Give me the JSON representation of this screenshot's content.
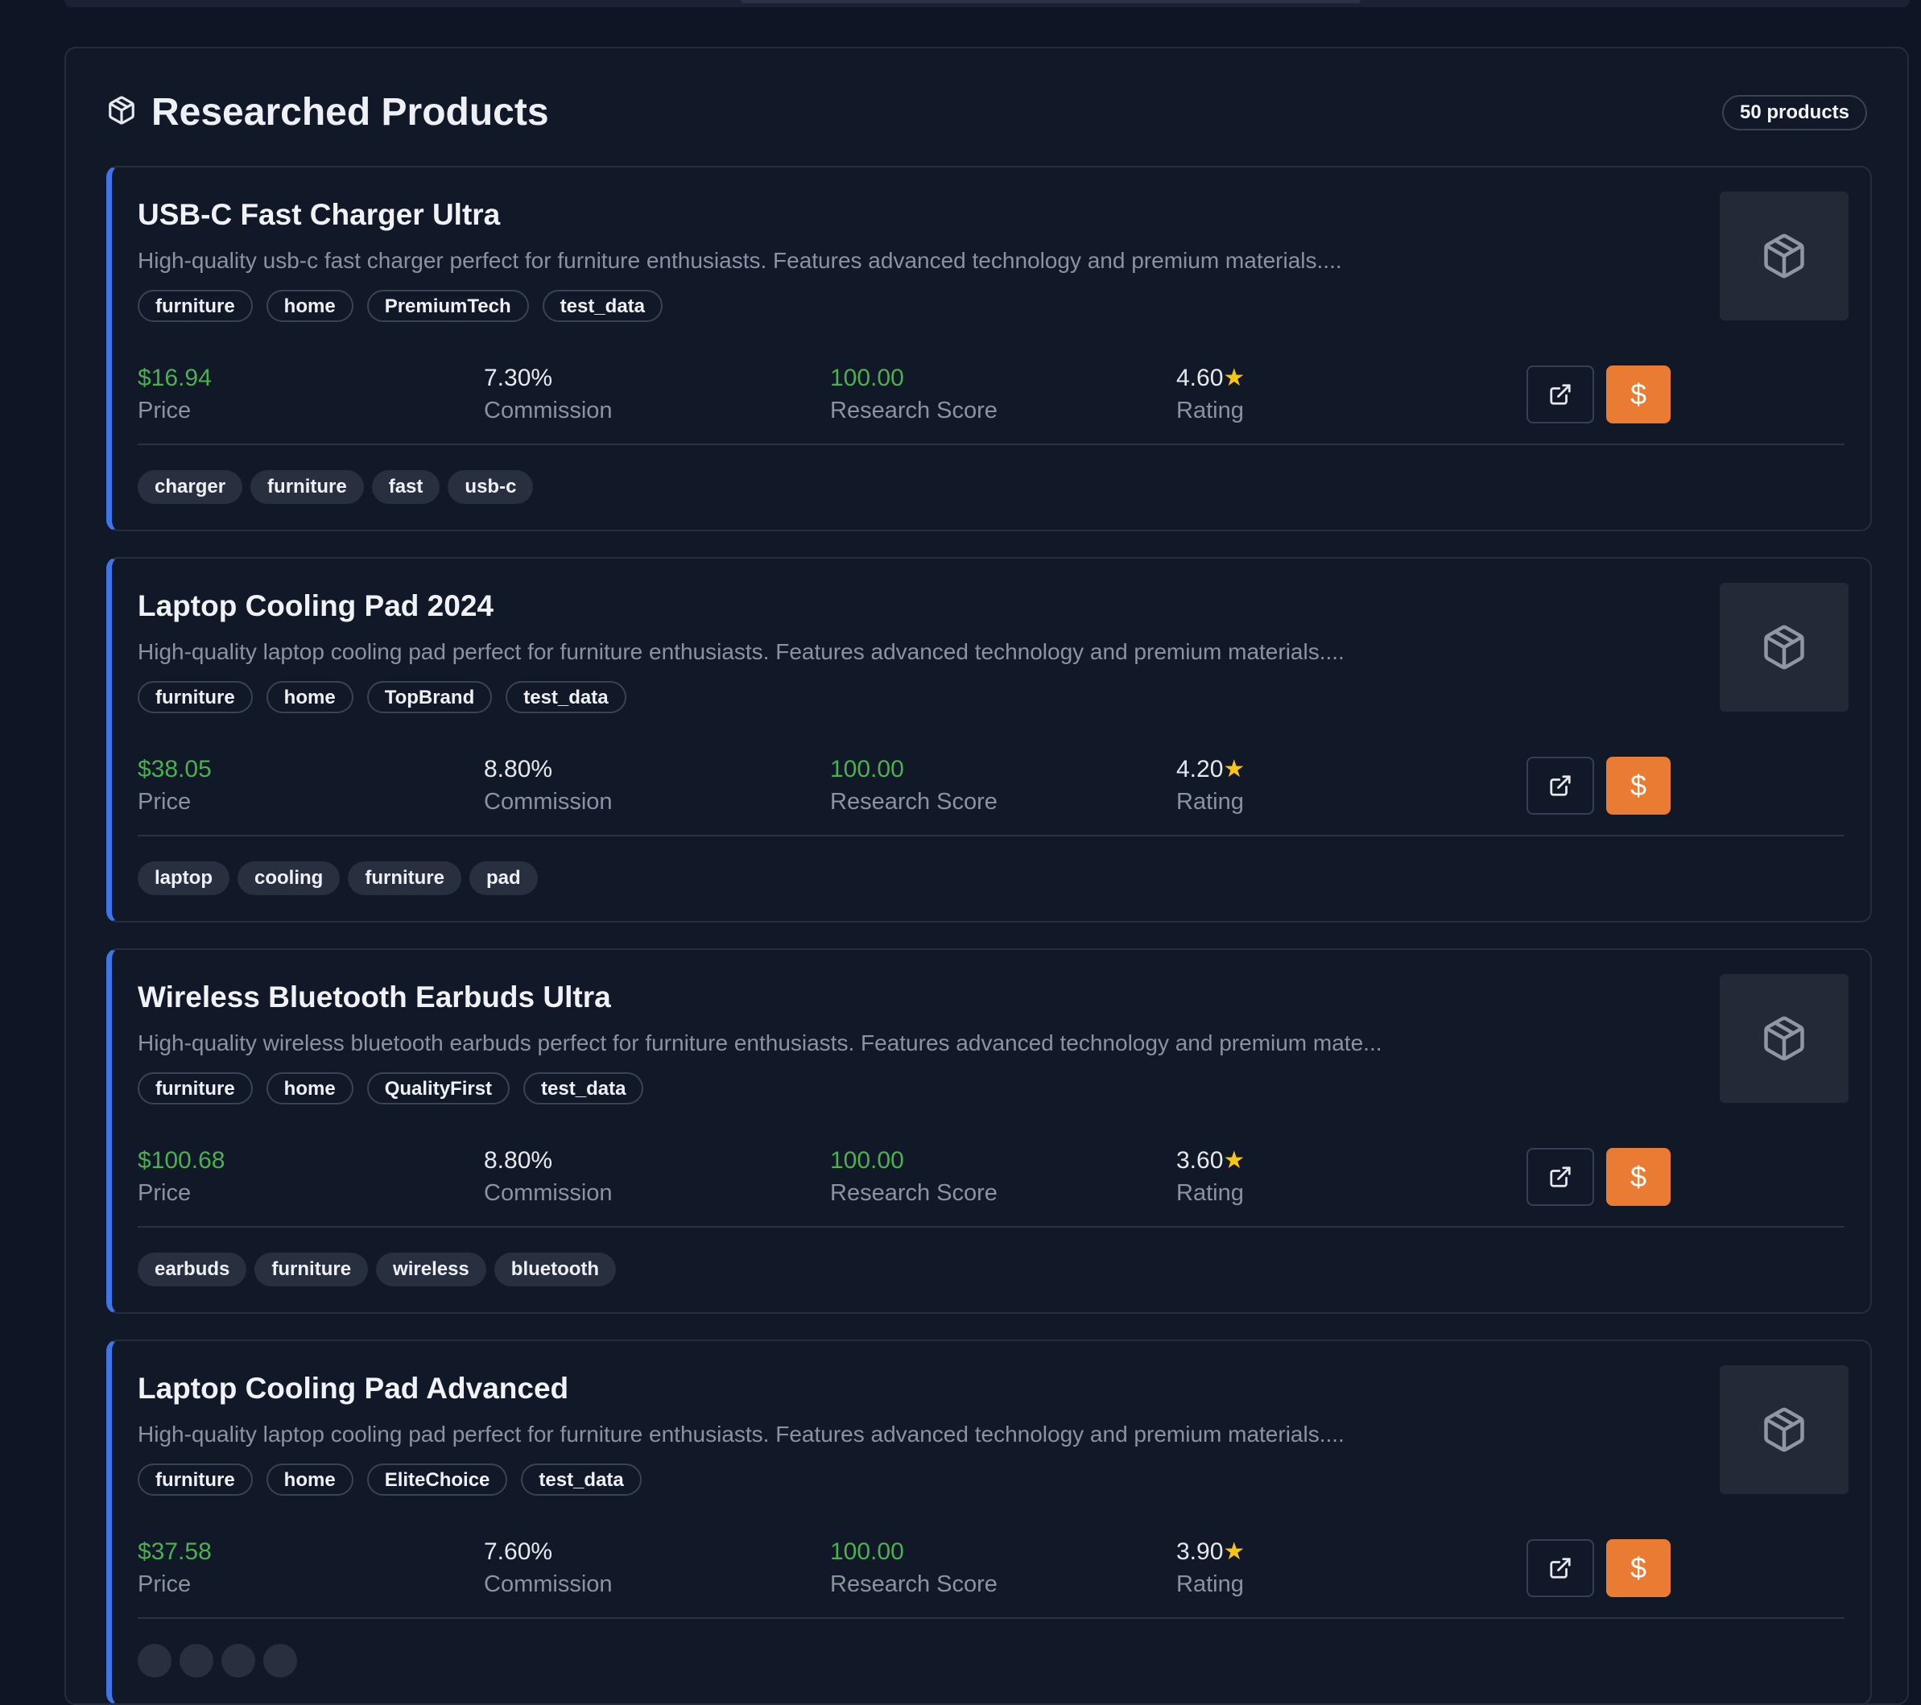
{
  "section": {
    "title": "Researched Products",
    "count_label": "50 products"
  },
  "labels": {
    "price": "Price",
    "commission": "Commission",
    "research_score": "Research Score",
    "rating": "Rating"
  },
  "colors": {
    "accent_border": "#3f75e6",
    "price_green": "#4caf50",
    "buy_orange": "#ea7b32",
    "star_yellow": "#f5c518"
  },
  "icons": {
    "section": "package-icon",
    "thumbnail": "package-icon",
    "open_link": "external-link-icon",
    "buy": "dollar-icon",
    "rating": "star-icon"
  },
  "products": [
    {
      "name": "USB-C Fast Charger Ultra",
      "description": "High-quality usb-c fast charger perfect for furniture enthusiasts. Features advanced technology and premium materials....",
      "categories": [
        "furniture",
        "home",
        "PremiumTech",
        "test_data"
      ],
      "price": "$16.94",
      "commission": "7.30%",
      "research_score": "100.00",
      "rating": "4.60",
      "tags": [
        "charger",
        "furniture",
        "fast",
        "usb-c"
      ]
    },
    {
      "name": "Laptop Cooling Pad 2024",
      "description": "High-quality laptop cooling pad perfect for furniture enthusiasts. Features advanced technology and premium materials....",
      "categories": [
        "furniture",
        "home",
        "TopBrand",
        "test_data"
      ],
      "price": "$38.05",
      "commission": "8.80%",
      "research_score": "100.00",
      "rating": "4.20",
      "tags": [
        "laptop",
        "cooling",
        "furniture",
        "pad"
      ]
    },
    {
      "name": "Wireless Bluetooth Earbuds Ultra",
      "description": "High-quality wireless bluetooth earbuds perfect for furniture enthusiasts. Features advanced technology and premium mate...",
      "categories": [
        "furniture",
        "home",
        "QualityFirst",
        "test_data"
      ],
      "price": "$100.68",
      "commission": "8.80%",
      "research_score": "100.00",
      "rating": "3.60",
      "tags": [
        "earbuds",
        "furniture",
        "wireless",
        "bluetooth"
      ]
    },
    {
      "name": "Laptop Cooling Pad Advanced",
      "description": "High-quality laptop cooling pad perfect for furniture enthusiasts. Features advanced technology and premium materials....",
      "categories": [
        "furniture",
        "home",
        "EliteChoice",
        "test_data"
      ],
      "price": "$37.58",
      "commission": "7.60%",
      "research_score": "100.00",
      "rating": "3.90",
      "tags": [
        "",
        "",
        "",
        ""
      ]
    }
  ]
}
